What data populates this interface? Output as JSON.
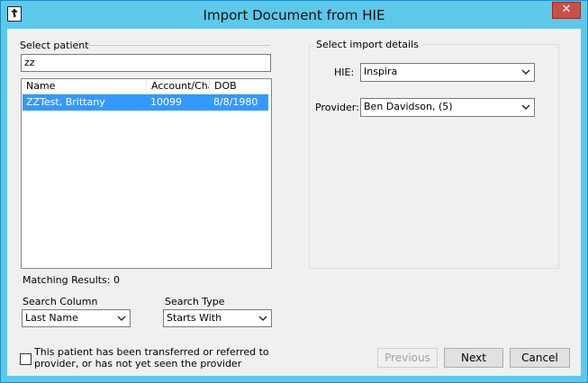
{
  "window": {
    "title": "Import Document from HIE",
    "icon": "document-cross-icon",
    "close_glyph": "✕"
  },
  "patient": {
    "section_label": "Select patient",
    "search_value": "zz",
    "columns": [
      "Name",
      "Account/Cha",
      "DOB"
    ],
    "rows": [
      {
        "name": "ZZTest, Brittany",
        "account": "10099",
        "dob": "8/8/1980",
        "selected": true
      }
    ],
    "matching_results": "Matching Results: 0"
  },
  "search": {
    "column_label": "Search Column",
    "column_value": "Last Name",
    "type_label": "Search Type",
    "type_value": "Starts With"
  },
  "transfer_checkbox": {
    "checked": false,
    "label_line1": "This patient has been transferred or referred to",
    "label_line2": "provider, or has not yet seen the provider"
  },
  "import_details": {
    "section_label": "Select import details",
    "hie_label": "HIE:",
    "hie_value": "Inspira",
    "provider_label": "Provider:",
    "provider_value": "Ben Davidson,  (5)"
  },
  "buttons": {
    "previous": "Previous",
    "next": "Next",
    "cancel": "Cancel"
  },
  "colors": {
    "titlebar": "#5ec8ea",
    "selection": "#3399ff",
    "close": "#c7504a"
  }
}
